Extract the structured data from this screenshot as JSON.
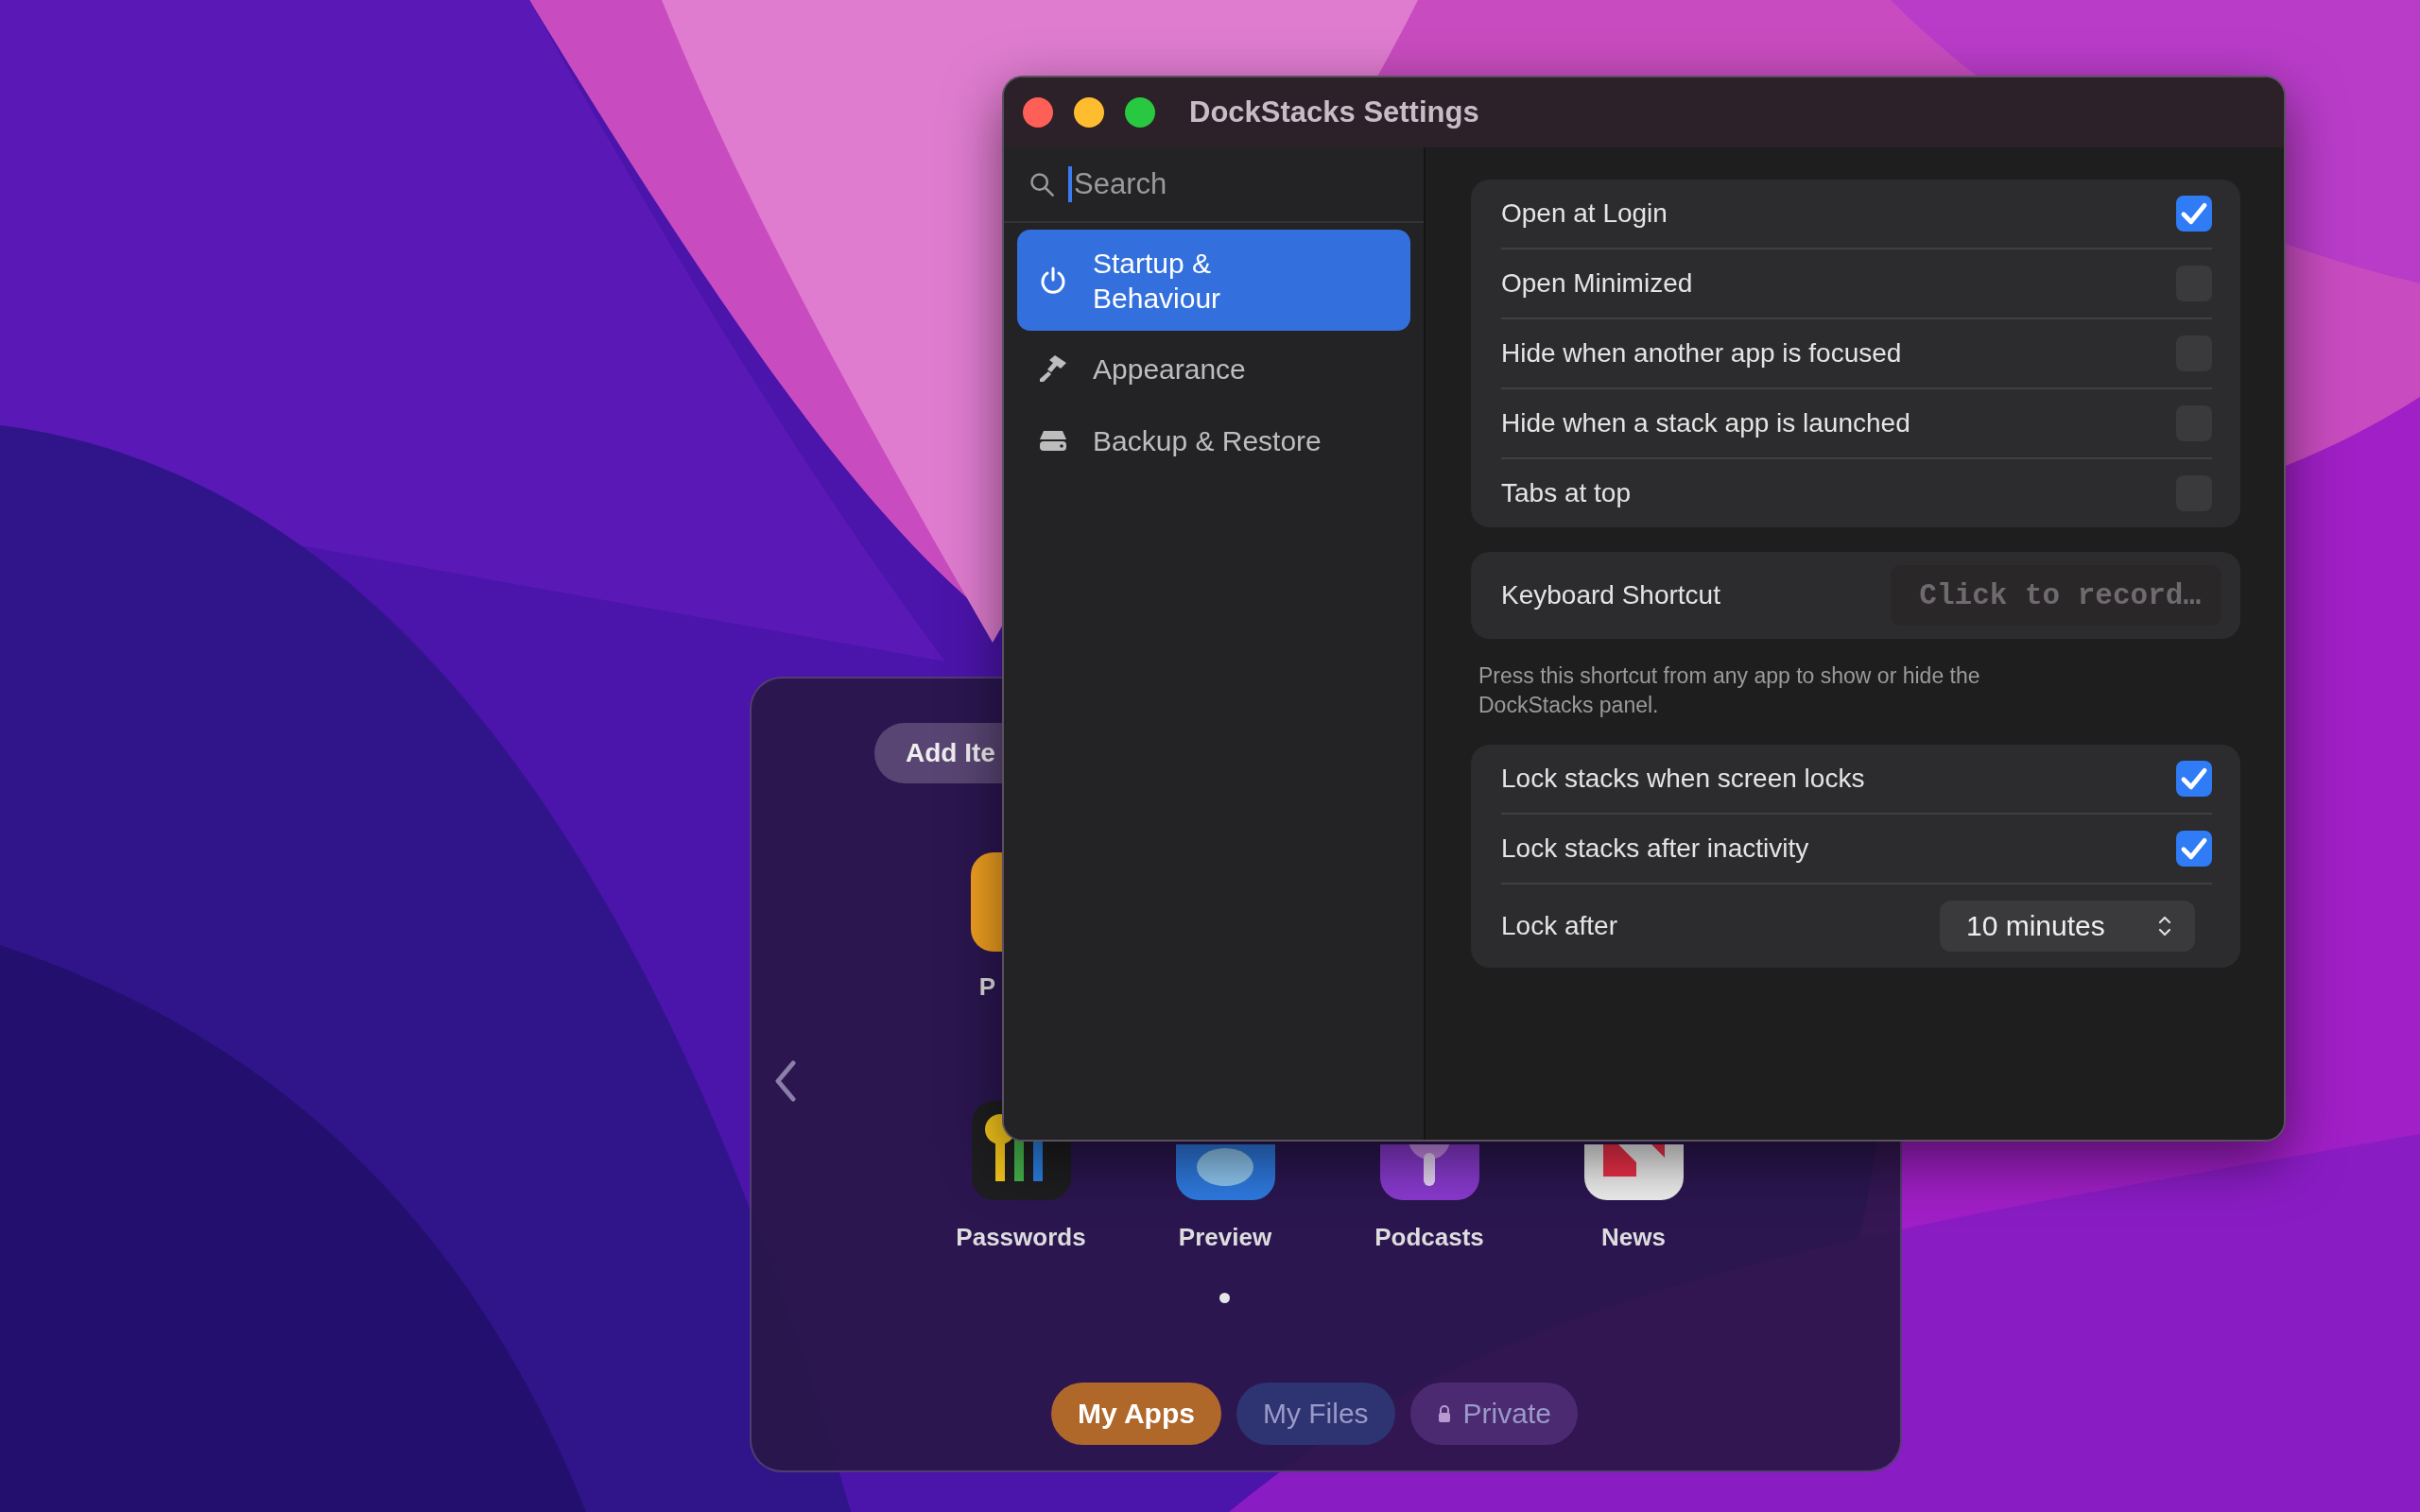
{
  "window": {
    "title": "DockStacks Settings"
  },
  "sidebar": {
    "search": {
      "placeholder": "Search"
    },
    "items": [
      {
        "label": "Startup & Behaviour",
        "selected": true
      },
      {
        "label": "Appearance",
        "selected": false
      },
      {
        "label": "Backup & Restore",
        "selected": false
      }
    ]
  },
  "general_settings": [
    {
      "label": "Open at Login",
      "checked": true
    },
    {
      "label": "Open Minimized",
      "checked": false
    },
    {
      "label": "Hide when another app is focused",
      "checked": false
    },
    {
      "label": "Hide when a stack app is launched",
      "checked": false
    },
    {
      "label": "Tabs at top",
      "checked": false
    }
  ],
  "shortcut": {
    "label": "Keyboard Shortcut",
    "placeholder": "Click to record…",
    "note": "Press this shortcut from any app to show or hide the DockStacks panel."
  },
  "lock_settings": [
    {
      "kind": "checkbox",
      "label": "Lock stacks when screen locks",
      "checked": true
    },
    {
      "kind": "checkbox",
      "label": "Lock stacks after inactivity",
      "checked": true
    },
    {
      "kind": "popup",
      "label": "Lock after",
      "value": "10 minutes"
    }
  ],
  "stack_panel": {
    "add_button": "Add Ite",
    "partial_app": {
      "label": "P"
    },
    "apps": [
      {
        "label": "Passwords"
      },
      {
        "label": "Preview"
      },
      {
        "label": "Podcasts"
      },
      {
        "label": "News"
      }
    ],
    "tabs": [
      {
        "label": "My Apps",
        "selected": true,
        "locked": false,
        "color": "#b0672a"
      },
      {
        "label": "My Files",
        "selected": false,
        "locked": false,
        "color": "#2e3472"
      },
      {
        "label": "Private",
        "selected": false,
        "locked": true,
        "color": "#4b2a72"
      }
    ]
  }
}
